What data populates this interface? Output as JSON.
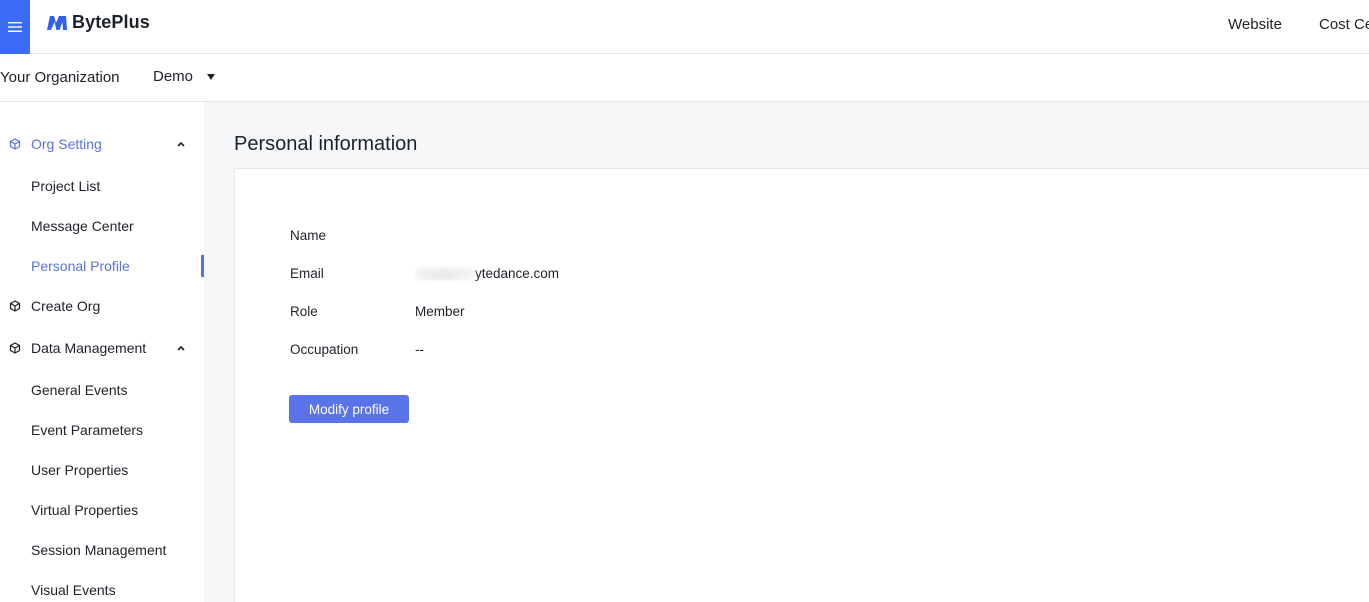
{
  "header": {
    "brand": "BytePlus",
    "links": [
      "Website",
      "Cost Ce"
    ]
  },
  "org": {
    "label": "Your Organization",
    "selected": "Demo"
  },
  "sidebar": {
    "groups": [
      {
        "label": "Org Setting",
        "active": true,
        "expanded": true,
        "items": [
          "Project List",
          "Message Center",
          "Personal Profile"
        ]
      },
      {
        "label": "Create Org",
        "active": false
      },
      {
        "label": "Data Management",
        "active": false,
        "expanded": true,
        "items": [
          "General Events",
          "Event Parameters",
          "User Properties",
          "Virtual Properties",
          "Session Management",
          "Visual Events"
        ]
      }
    ],
    "selected_item": "Personal Profile"
  },
  "main": {
    "title": "Personal information",
    "fields": [
      {
        "label": "Name",
        "value": ""
      },
      {
        "label": "Email",
        "value": "ytedance.com"
      },
      {
        "label": "Role",
        "value": "Member"
      },
      {
        "label": "Occupation",
        "value": "--"
      }
    ],
    "modify_button": "Modify profile"
  },
  "colors": {
    "primary": "#3c6cf5",
    "accent": "#5872e0",
    "button": "#5a73e8",
    "main_bg": "#f6f7f9"
  },
  "icons": {
    "menu": "menu-icon",
    "group": "cube-icon",
    "chevron": "chevron-up-icon",
    "dropdown": "caret-down-icon"
  }
}
